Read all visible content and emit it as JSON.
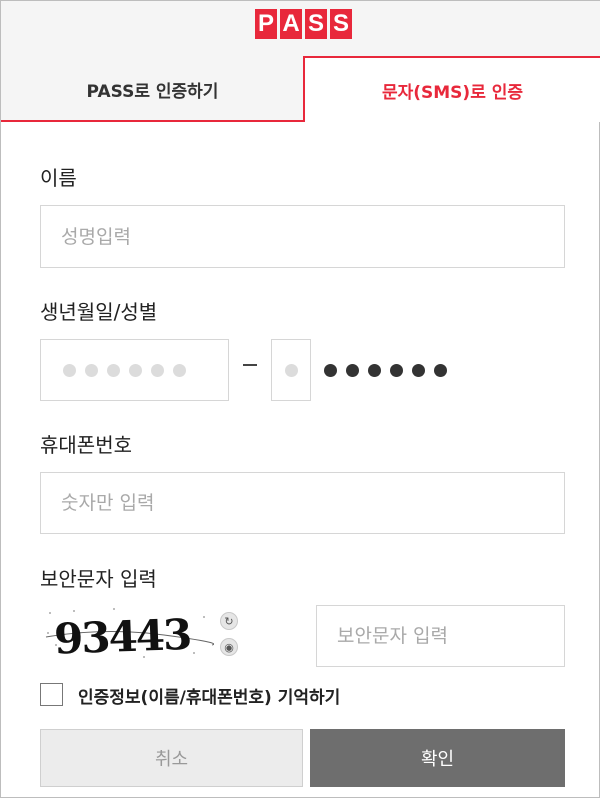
{
  "header": {
    "logo_letters": [
      "P",
      "A",
      "S",
      "S"
    ]
  },
  "tabs": [
    {
      "label": "PASS로 인증하기",
      "active": false
    },
    {
      "label": "문자(SMS)로 인증",
      "active": true
    }
  ],
  "form": {
    "name_label": "이름",
    "name_placeholder": "성명입력",
    "birth_label": "생년월일/성별",
    "phone_label": "휴대폰번호",
    "phone_placeholder": "숫자만 입력",
    "captcha_label": "보안문자 입력",
    "captcha_text": "93443",
    "captcha_placeholder": "보안문자 입력",
    "remember_label": "인증정보(이름/휴대폰번호) 기억하기"
  },
  "buttons": {
    "cancel": "취소",
    "confirm": "확인"
  },
  "colors": {
    "accent": "#e8283b",
    "confirm_bg": "#6e6e6e",
    "cancel_bg": "#ececec"
  }
}
